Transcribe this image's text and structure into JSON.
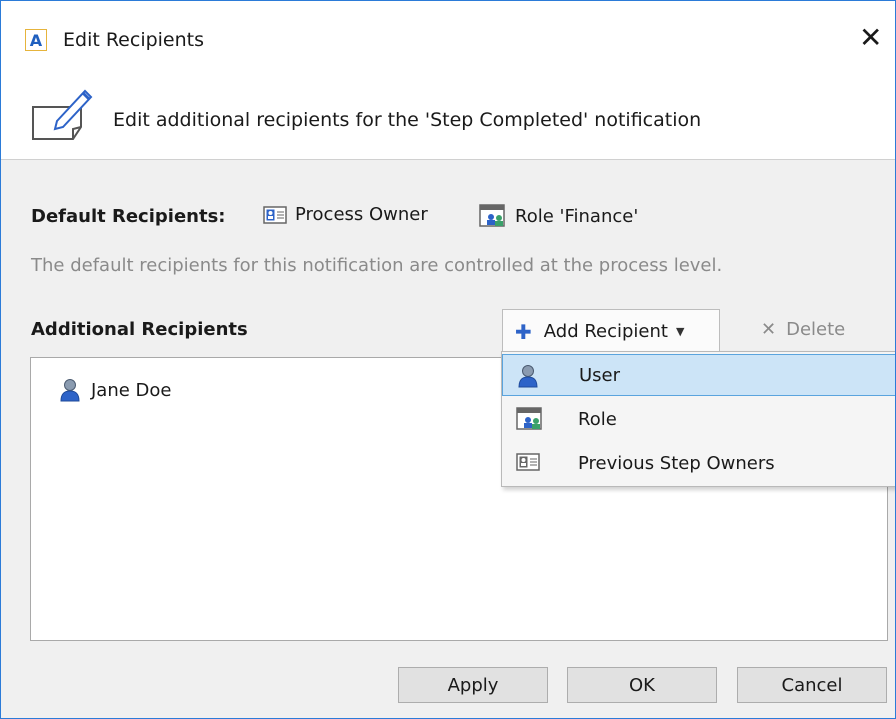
{
  "window": {
    "app_icon_letter": "A",
    "title": "Edit Recipients",
    "close_glyph": "✕"
  },
  "header": {
    "text": "Edit additional recipients for the 'Step Completed' notification",
    "icon": "pencil-note-icon"
  },
  "default_recipients": {
    "label": "Default Recipients:",
    "items": [
      {
        "label": "Process Owner",
        "icon": "contact-card-icon"
      },
      {
        "label": "Role 'Finance'",
        "icon": "role-icon"
      }
    ],
    "hint": "The default recipients for this notification are controlled at the process level."
  },
  "additional_recipients": {
    "label": "Additional Recipients",
    "items": [
      {
        "label": "Jane Doe",
        "icon": "user-icon"
      }
    ]
  },
  "toolbar": {
    "add_label": "Add Recipient",
    "delete_label": "Delete"
  },
  "add_menu": {
    "items": [
      {
        "label": "User",
        "icon": "user-icon",
        "highlighted": true
      },
      {
        "label": "Role",
        "icon": "role-icon"
      },
      {
        "label": "Previous Step Owners",
        "icon": "contact-card-icon"
      }
    ]
  },
  "buttons": {
    "apply": "Apply",
    "ok": "OK",
    "cancel": "Cancel"
  },
  "colors": {
    "accent_blue": "#2b7bd8",
    "menu_highlight": "#cce4f7"
  }
}
